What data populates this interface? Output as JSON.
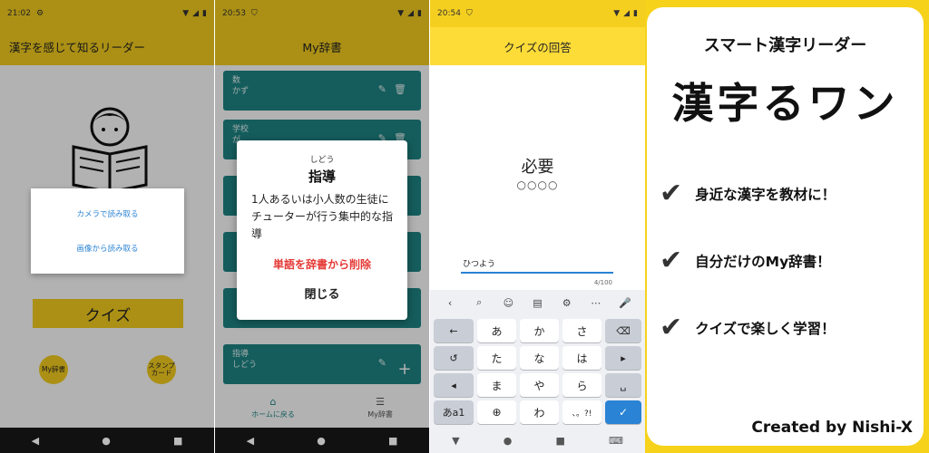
{
  "phone1": {
    "status_time": "21:02",
    "appbar_title": "漢字を感じて知るリーダー",
    "sheet_items": [
      "カメラで読み取る",
      "画像から読み取る"
    ],
    "quiz_label": "クイズ",
    "my_dict_label": "My辞書",
    "stamp_card_label": "スタンプカード"
  },
  "phone2": {
    "status_time": "20:53",
    "appbar_title": "My辞書",
    "cards": [
      {
        "word": "数",
        "reading": "かず"
      },
      {
        "word": "学校",
        "reading": "が"
      },
      {
        "word": "",
        "reading": ""
      },
      {
        "word": "",
        "reading": ""
      },
      {
        "word": "",
        "reading": ""
      },
      {
        "word": "指導",
        "reading": "しどう"
      }
    ],
    "dialog": {
      "yomi": "しどう",
      "kanji": "指導",
      "meaning": "1人あるいは小人数の生徒にチューターが行う集中的な指導",
      "delete_label": "単語を辞書から削除",
      "close_label": "閉じる"
    },
    "bottom_nav": {
      "home": "ホームに戻る",
      "dict": "My辞書"
    }
  },
  "phone3": {
    "status_time": "20:54",
    "appbar_title": "クイズの回答",
    "question_kanji": "必要",
    "question_mask": "○○○○",
    "answer_value": "ひつよう",
    "counter": "4/100",
    "keys": {
      "row1": [
        "あ",
        "か",
        "さ"
      ],
      "row2": [
        "た",
        "な",
        "は"
      ],
      "row3": [
        "ま",
        "や",
        "ら"
      ],
      "row4": [
        "わ",
        "、。?!"
      ],
      "mode": "あa1"
    }
  },
  "promo": {
    "subtitle": "スマート漢字リーダー",
    "logo_text": "漢字るワン",
    "features": [
      "身近な漢字を教材に！",
      "自分だけのMy辞書！",
      "クイズで楽しく学習！"
    ],
    "credit": "Created by Nishi-X"
  },
  "colors": {
    "accent_yellow": "#f5cf1f",
    "teal": "#1f8686",
    "link_blue": "#2a83d4",
    "danger_red": "#e53935"
  }
}
